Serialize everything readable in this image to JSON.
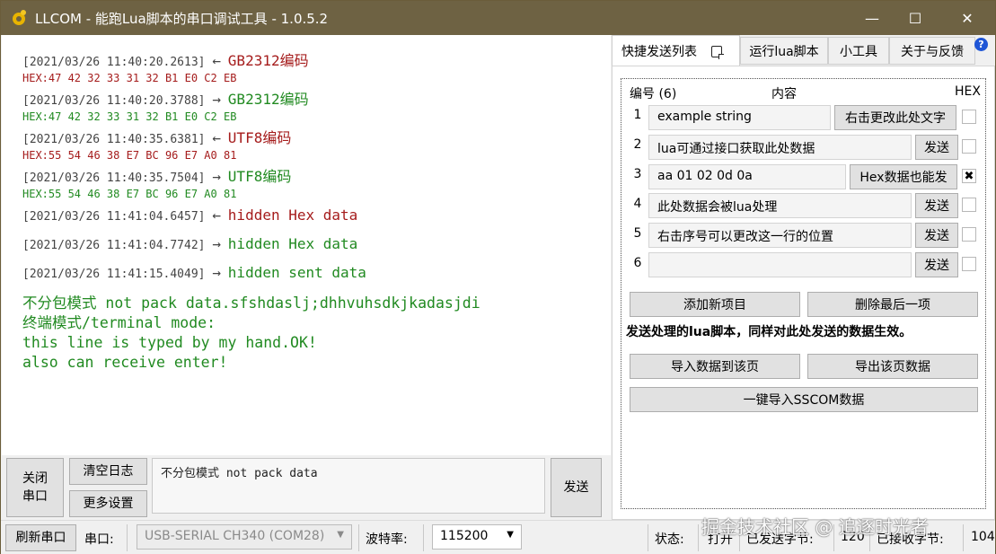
{
  "window": {
    "title": "LLCOM - 能跑Lua脚本的串口调试工具 - 1.0.5.2",
    "icon": "app-gear-icon",
    "controls": {
      "minimize": "—",
      "maximize": "☐",
      "close": "✕"
    }
  },
  "log": {
    "entries": [
      {
        "timestamp": "[2021/03/26 11:40:20.2613]",
        "arrow": "←",
        "message": "GB2312编码",
        "hex": "HEX:47 42 32 33 31 32 B1 E0 C2 EB",
        "color": "#a51c1c"
      },
      {
        "timestamp": "[2021/03/26 11:40:20.3788]",
        "arrow": "→",
        "message": "GB2312编码",
        "hex": "HEX:47 42 32 33 31 32 B1 E0 C2 EB",
        "color": "#218a21"
      },
      {
        "timestamp": "[2021/03/26 11:40:35.6381]",
        "arrow": "←",
        "message": "UTF8编码",
        "hex": "HEX:55 54 46 38 E7 BC 96 E7 A0 81",
        "color": "#a51c1c"
      },
      {
        "timestamp": "[2021/03/26 11:40:35.7504]",
        "arrow": "→",
        "message": "UTF8编码",
        "hex": "HEX:55 54 46 38 E7 BC 96 E7 A0 81",
        "color": "#218a21"
      },
      {
        "timestamp": "[2021/03/26 11:41:04.6457]",
        "arrow": "←",
        "message": "hidden Hex data",
        "color": "#a51c1c"
      },
      {
        "timestamp": "[2021/03/26 11:41:04.7742]",
        "arrow": "→",
        "message": "hidden Hex data",
        "color": "#218a21"
      },
      {
        "timestamp": "[2021/03/26 11:41:15.4049]",
        "arrow": "→",
        "message": "hidden sent data",
        "color": "#218a21"
      }
    ],
    "plain_lines": [
      "不分包模式 not pack data.sfshdaslj;dhhvuhsdkjkadasjdi",
      "终端模式/terminal mode:",
      "this line is typed by my hand.OK!",
      "also can receive enter!"
    ]
  },
  "send_area": {
    "close_port": "关闭\n串口",
    "clear_log": "清空日志",
    "more_settings": "更多设置",
    "input_value": "不分包模式 not pack data",
    "send": "发送"
  },
  "statusbar": {
    "refresh": "刷新串口",
    "port_label": "串口:",
    "port_value": "USB-SERIAL CH340 (COM28)",
    "baud_label": "波特率:",
    "baud_value": "115200",
    "state_label": "状态:",
    "state_value": "打开",
    "sent_label": "已发送字节:",
    "sent_value": "120",
    "recv_label": "已接收字节:",
    "recv_value": "104"
  },
  "tabs": [
    {
      "label": "快捷发送列表",
      "active": true
    },
    {
      "label": "运行lua脚本"
    },
    {
      "label": "小工具"
    },
    {
      "label": "关于与反馈"
    }
  ],
  "quick_send": {
    "header_no": "编号 (6)",
    "header_content": "内容",
    "header_hex": "HEX",
    "rows": [
      {
        "no": "1",
        "value": "example string",
        "button": "右击更改此处文字",
        "hex": false
      },
      {
        "no": "2",
        "value": "lua可通过接口获取此处数据",
        "button": "发送",
        "hex": false
      },
      {
        "no": "3",
        "value": "aa 01 02 0d 0a",
        "button": "Hex数据也能发",
        "hex": true
      },
      {
        "no": "4",
        "value": "此处数据会被lua处理",
        "button": "发送",
        "hex": false
      },
      {
        "no": "5",
        "value": "右击序号可以更改这一行的位置",
        "button": "发送",
        "hex": false
      },
      {
        "no": "6",
        "value": "",
        "button": "发送",
        "hex": false
      }
    ],
    "add_item": "添加新项目",
    "remove_last": "删除最后一项",
    "info": "发送处理的lua脚本，同样对此处发送的数据生效。",
    "import_page": "导入数据到该页",
    "export_page": "导出该页数据",
    "import_sscom": "一键导入SSCOM数据",
    "check_mark": "✖"
  },
  "watermark": "掘金技术社区 @ 追逐时光者"
}
